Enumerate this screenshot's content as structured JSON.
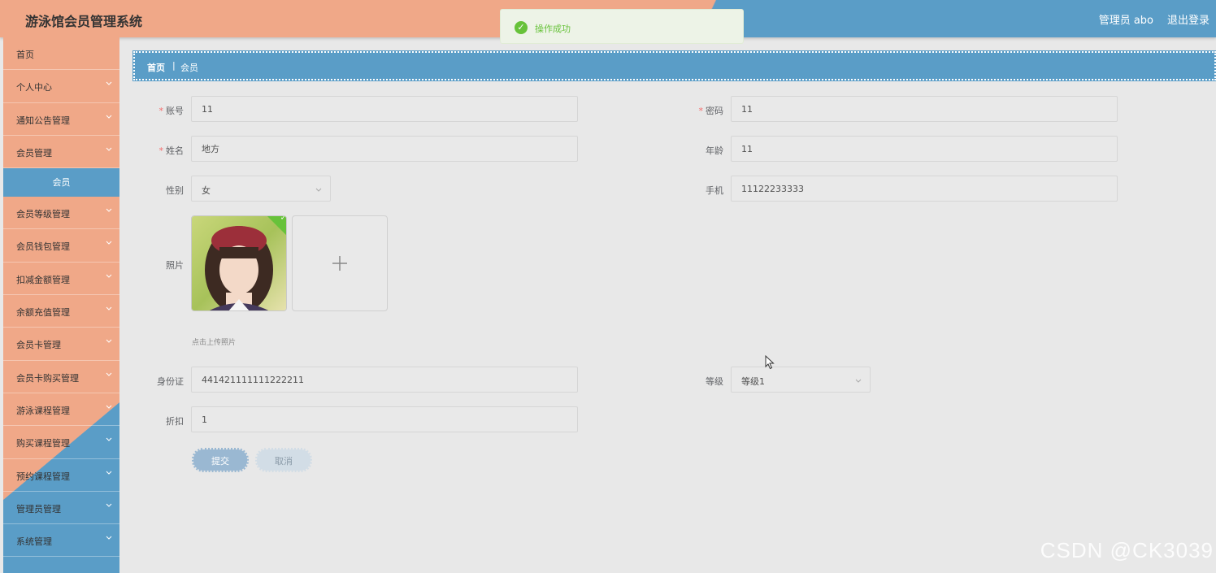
{
  "app": {
    "title": "游泳馆会员管理系统"
  },
  "header": {
    "user": "管理员 abo",
    "logout": "退出登录"
  },
  "toast": {
    "text": "操作成功",
    "icon": "check-circle-icon"
  },
  "sidebar": {
    "items": [
      {
        "label": "首页",
        "chevron": false
      },
      {
        "label": "个人中心",
        "chevron": true
      },
      {
        "label": "通知公告管理",
        "chevron": true
      },
      {
        "label": "会员管理",
        "chevron": true,
        "sub": "会员"
      },
      {
        "label": "会员等级管理",
        "chevron": true
      },
      {
        "label": "会员钱包管理",
        "chevron": true
      },
      {
        "label": "扣减金额管理",
        "chevron": true
      },
      {
        "label": "余额充值管理",
        "chevron": true
      },
      {
        "label": "会员卡管理",
        "chevron": true
      },
      {
        "label": "会员卡购买管理",
        "chevron": true
      },
      {
        "label": "游泳课程管理",
        "chevron": true
      },
      {
        "label": "购买课程管理",
        "chevron": true
      },
      {
        "label": "预约课程管理",
        "chevron": true
      },
      {
        "label": "管理员管理",
        "chevron": true
      },
      {
        "label": "系统管理",
        "chevron": true
      }
    ]
  },
  "breadcrumb": {
    "home": "首页",
    "separator": "|",
    "current": "会员"
  },
  "form": {
    "account": {
      "label": "账号",
      "required": "*",
      "value": "11"
    },
    "password": {
      "label": "密码",
      "required": "*",
      "value": "11"
    },
    "name": {
      "label": "姓名",
      "required": "*",
      "value": "地方"
    },
    "age": {
      "label": "年龄",
      "value": "11"
    },
    "gender": {
      "label": "性别",
      "value": "女"
    },
    "phone": {
      "label": "手机",
      "value": "11122233333"
    },
    "photo": {
      "label": "照片",
      "tip": "点击上传照片"
    },
    "idcard": {
      "label": "身份证",
      "value": "441421111111222211"
    },
    "level": {
      "label": "等级",
      "value": "等级1"
    },
    "discount": {
      "label": "折扣",
      "value": "1"
    },
    "submit": "提交",
    "cancel": "取消"
  },
  "watermark": "CSDN @CK3039",
  "colors": {
    "salmon": "#f0a888",
    "blue": "#5a9dc7",
    "success": "#67c23a",
    "required": "#f56c6c"
  }
}
